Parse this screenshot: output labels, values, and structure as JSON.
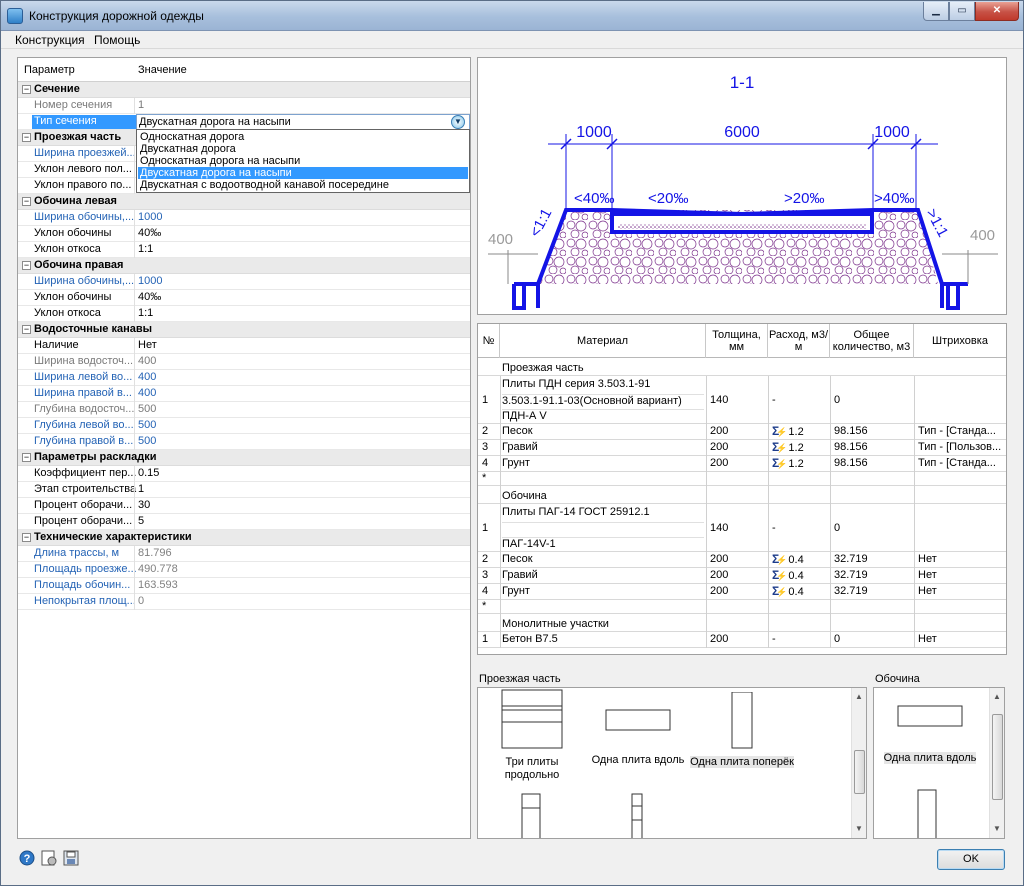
{
  "window": {
    "title": "Конструкция дорожной одежды"
  },
  "menu": [
    "Конструкция",
    "Помощь"
  ],
  "property_grid": {
    "col_param": "Параметр",
    "col_value": "Значение",
    "groups": [
      {
        "label": "Сечение"
      },
      {
        "label": "Проезжая часть"
      },
      {
        "label": "Обочина левая"
      },
      {
        "label": "Обочина правая"
      },
      {
        "label": "Водосточные канавы"
      },
      {
        "label": "Параметры раскладки"
      },
      {
        "label": "Технические характеристики"
      }
    ],
    "rows": {
      "nomer_secheniya": {
        "name": "Номер сечения",
        "value": "1"
      },
      "tip_secheniya": {
        "name": "Тип сечения",
        "value": "Двускатная дорога на насыпи"
      },
      "shirina_proezzhey": {
        "name": "Ширина проезжей..."
      },
      "uklon_levogo": {
        "name": "Уклон левого пол..."
      },
      "uklon_pravogo": {
        "name": "Уклон правого по..."
      },
      "l_shirina": {
        "name": "Ширина обочины,...",
        "value": "1000"
      },
      "l_uklon": {
        "name": "Уклон обочины",
        "value": "40‰"
      },
      "l_otkos": {
        "name": "Уклон откоса",
        "value": "1:1"
      },
      "r_shirina": {
        "name": "Ширина обочины,...",
        "value": "1000"
      },
      "r_uklon": {
        "name": "Уклон обочины",
        "value": "40‰"
      },
      "r_otkos": {
        "name": "Уклон откоса",
        "value": "1:1"
      },
      "nalichie": {
        "name": "Наличие",
        "value": "Нет"
      },
      "shirina_vodostoch": {
        "name": "Ширина водосточ...",
        "value": "400"
      },
      "shirina_levoy": {
        "name": "Ширина левой во...",
        "value": "400"
      },
      "shirina_pravoy": {
        "name": "Ширина правой в...",
        "value": "400"
      },
      "glubina_vodostoch": {
        "name": "Глубина водосточ...",
        "value": "500"
      },
      "glubina_levoy": {
        "name": "Глубина левой во...",
        "value": "500"
      },
      "glubina_pravoy": {
        "name": "Глубина правой в...",
        "value": "500"
      },
      "koeff": {
        "name": "Коэффициент пер...",
        "value": "0.15"
      },
      "etap": {
        "name": "Этап строительства",
        "value": "1"
      },
      "procent1": {
        "name": "Процент оборачи...",
        "value": "30"
      },
      "procent2": {
        "name": "Процент оборачи...",
        "value": "5"
      },
      "dlina": {
        "name": "Длина трассы, м",
        "value": "81.796"
      },
      "ploshad_proezzh": {
        "name": "Площадь проезже...",
        "value": "490.778"
      },
      "ploshad_obochin": {
        "name": "Площадь обочин...",
        "value": "163.593"
      },
      "nepokrytaya": {
        "name": "Непокрытая площ...",
        "value": "0"
      }
    },
    "dropdown_options": [
      "Односкатная дорога",
      "Двускатная дорога",
      "Односкатная дорога на насыпи",
      "Двускатная дорога на насыпи",
      "Двускатная с водоотводной канавой посередине"
    ],
    "dropdown_selected_index": 3
  },
  "drawing": {
    "section_label": "1-1",
    "dim_left": "1000",
    "dim_center": "6000",
    "dim_right": "1000",
    "slope_l_outer": "<40‰",
    "slope_l_inner": "<20‰",
    "slope_r_inner": ">20‰",
    "slope_r_outer": ">40‰",
    "otkos_l": "<1:1",
    "otkos_r": ">1:1",
    "ditch_l": "400",
    "ditch_r": "400"
  },
  "materials": {
    "headers": {
      "n": "№",
      "material": "Материал",
      "thickness": "Толщина, мм",
      "rate": "Расход, м3/м",
      "total": "Общее количество, м3",
      "hatch": "Штриховка"
    },
    "sections": {
      "proezzhaya": "Проезжая часть",
      "obochina": "Обочина",
      "monolit": "Монолитные участки"
    },
    "plates1": {
      "n": "1",
      "line1": "Плиты ПДН серия 3.503.1-91",
      "line2": "3.503.1-91.1-03(Основной вариант)",
      "line3": "ПДН-А V",
      "thickness": "140",
      "rate": "-",
      "total": "0"
    },
    "rows1": [
      {
        "n": "2",
        "material": "Песок",
        "thickness": "200",
        "rate": "1.2",
        "total": "98.156",
        "hatch": "Тип - [Станда..."
      },
      {
        "n": "3",
        "material": "Гравий",
        "thickness": "200",
        "rate": "1.2",
        "total": "98.156",
        "hatch": "Тип - [Пользов..."
      },
      {
        "n": "4",
        "material": "Грунт",
        "thickness": "200",
        "rate": "1.2",
        "total": "98.156",
        "hatch": "Тип - [Станда..."
      }
    ],
    "plates2": {
      "n": "1",
      "line1": "Плиты ПАГ-14 ГОСТ 25912.1",
      "line3": "ПАГ-14V-1",
      "thickness": "140",
      "rate": "-",
      "total": "0"
    },
    "rows2": [
      {
        "n": "2",
        "material": "Песок",
        "thickness": "200",
        "rate": "0.4",
        "total": "32.719",
        "hatch": "Нет"
      },
      {
        "n": "3",
        "material": "Гравий",
        "thickness": "200",
        "rate": "0.4",
        "total": "32.719",
        "hatch": "Нет"
      },
      {
        "n": "4",
        "material": "Грунт",
        "thickness": "200",
        "rate": "0.4",
        "total": "32.719",
        "hatch": "Нет"
      }
    ],
    "rows3": [
      {
        "n": "1",
        "material": "Бетон В7.5",
        "thickness": "200",
        "rate": "-",
        "total": "0",
        "hatch": "Нет"
      }
    ],
    "new_row_marker": "*"
  },
  "layouts": {
    "proezzhaya_label": "Проезжая часть",
    "obochina_label": "Обочина",
    "tile_three_l1": "Три плиты",
    "tile_three_l2": "продольно",
    "tile_one_along": "Одна плита вдоль",
    "tile_one_across": "Одна плита поперёк",
    "tile_obochina_along": "Одна плита вдоль"
  },
  "buttons": {
    "ok": "OK"
  },
  "colors": {
    "accent": "#3399ff",
    "drawing_blue": "#1414e6",
    "fill_purple": "#7a2e8a"
  }
}
